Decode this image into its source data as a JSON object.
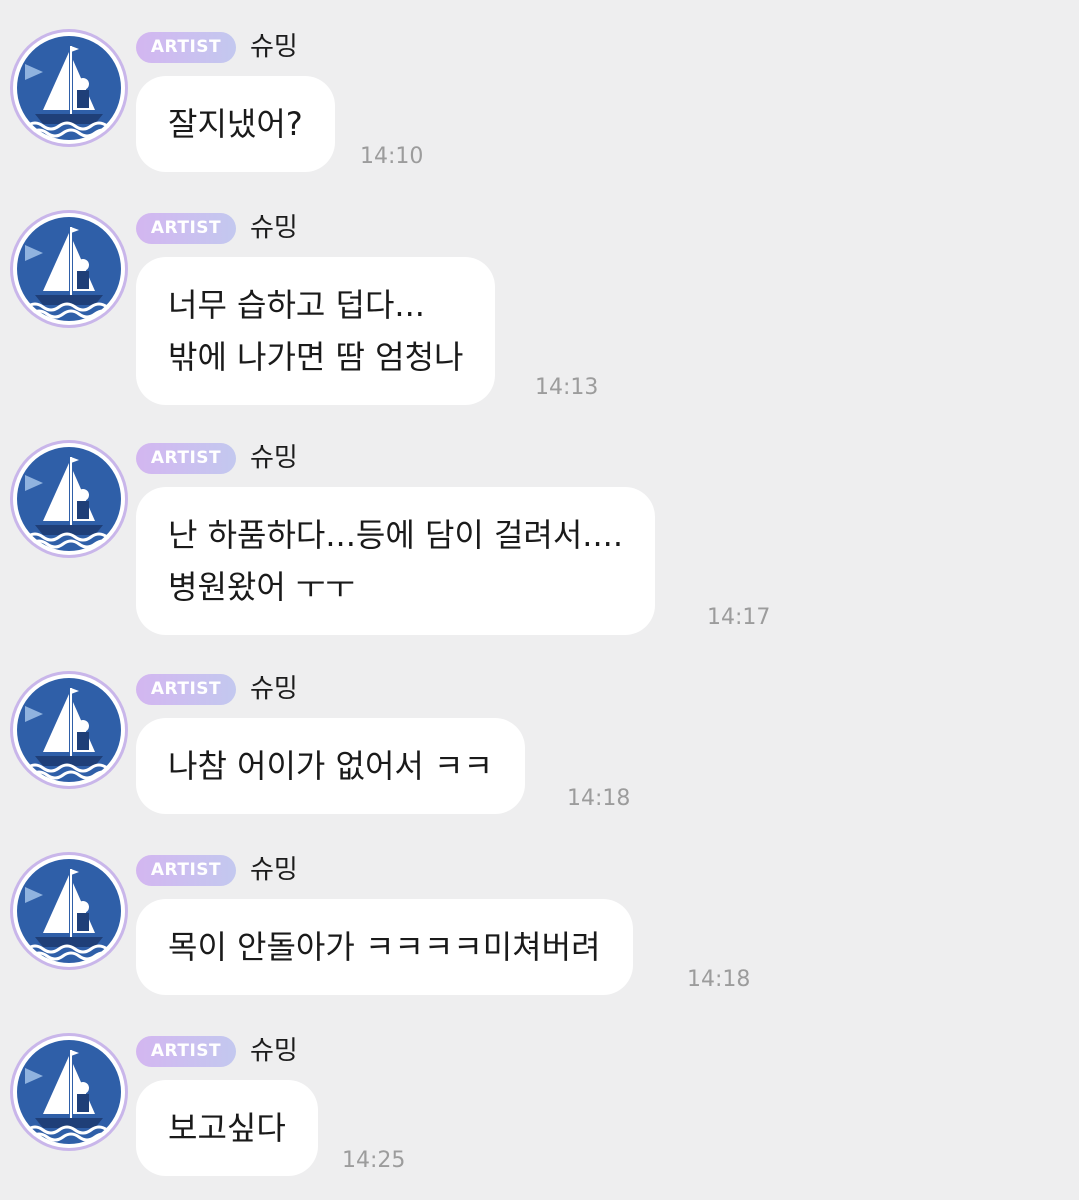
{
  "messages": [
    {
      "badge": "ARTIST",
      "name": "슈밍",
      "lines": [
        "잘지냈어?"
      ],
      "time": "14:10"
    },
    {
      "badge": "ARTIST",
      "name": "슈밍",
      "lines": [
        "너무 습하고 덥다...",
        "밖에 나가면 땀 엄청나"
      ],
      "time": "14:13"
    },
    {
      "badge": "ARTIST",
      "name": "슈밍",
      "lines": [
        "난 하품하다...등에 담이 걸려서....",
        "병원왔어 ㅜㅜ"
      ],
      "time": "14:17"
    },
    {
      "badge": "ARTIST",
      "name": "슈밍",
      "lines": [
        "나참 어이가 없어서 ㅋㅋ"
      ],
      "time": "14:18"
    },
    {
      "badge": "ARTIST",
      "name": "슈밍",
      "lines": [
        "목이 안돌아가 ㅋㅋㅋㅋ미쳐버려"
      ],
      "time": "14:18"
    },
    {
      "badge": "ARTIST",
      "name": "슈밍",
      "lines": [
        "보고싶다"
      ],
      "time": "14:25"
    }
  ],
  "colors": {
    "background": "#eeeeef",
    "bubble": "#ffffff",
    "badge_gradient_start": "#d3b6f0",
    "badge_gradient_end": "#c3c8ef",
    "avatar_blue": "#2f5fa8",
    "time": "#9c9c9c"
  },
  "icons": {
    "avatar": "sailboat-sailor-icon"
  }
}
